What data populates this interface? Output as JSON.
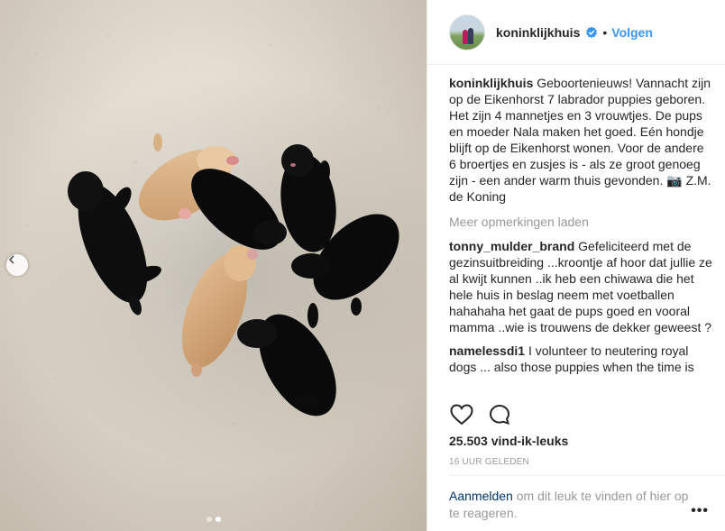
{
  "post": {
    "username": "koninklijkhuis",
    "follow_label": "Volgen",
    "bullet": "•",
    "caption": "Geboortenieuws! Vannacht zijn op de Eikenhorst 7 labrador puppies geboren. Het zijn 4 mannetjes en 3 vrouwtjes. De pups en moeder Nala maken het goed. Eén hondje blijft op de Eikenhorst wonen. Voor de andere 6 broertjes en zusjes is - als ze groot genoeg zijn - een ander warm thuis gevonden. 📷 Z.M. de Koning",
    "load_more": "Meer opmerkingen laden",
    "comments": [
      {
        "user": "tonny_mulder_brand",
        "text": "Gefeliciteerd met de gezinsuitbreiding ...kroontje af hoor dat jullie ze al kwijt kunnen ..ik heb een chiwawa die het hele huis in beslag neem met voetballen hahahaha het gaat de pups goed en vooral mamma ..wie is trouwens de dekker geweest ?"
      },
      {
        "user": "namelessdi1",
        "text": "I volunteer to neutering royal dogs ... also those puppies when the time is"
      }
    ],
    "likes": "25.503 vind-ik-leuks",
    "timestamp": "16 UUR GELEDEN",
    "login_link": "Aanmelden",
    "login_text": " om dit leuk te vinden of hier op te reageren.",
    "options": "•••"
  },
  "photo": {
    "carousel_dots": 2,
    "active_dot": 1
  },
  "colors": {
    "link_blue": "#3897f0",
    "login_link": "#003569",
    "muted": "#999999",
    "text": "#262626",
    "border": "#efefef"
  },
  "icons": {
    "prev": "chevron-left-icon",
    "verified": "verified-badge-icon",
    "like": "heart-outline-icon",
    "comment": "comment-bubble-icon",
    "options": "more-options-icon"
  }
}
